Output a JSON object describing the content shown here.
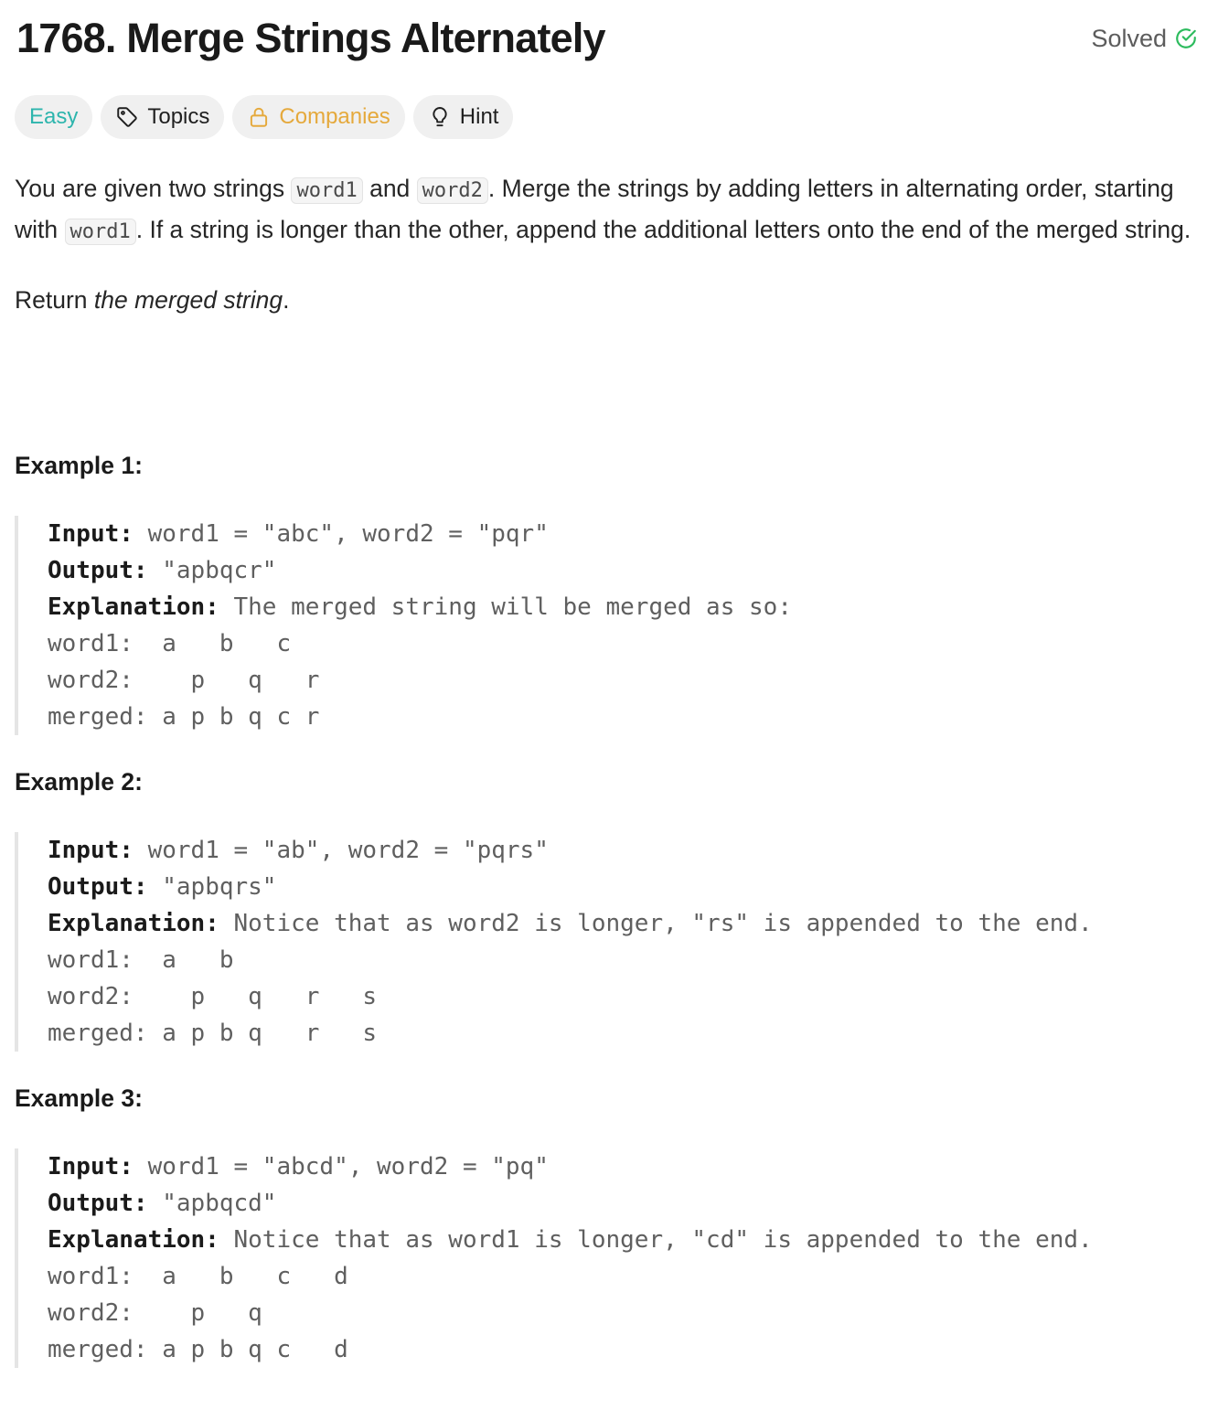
{
  "problem": {
    "title": "1768. Merge Strings Alternately",
    "status": "Solved"
  },
  "tags": {
    "difficulty": "Easy",
    "topics": "Topics",
    "companies": "Companies",
    "hint": "Hint"
  },
  "colors": {
    "easy": "#2db5ad",
    "companies": "#e5a93c",
    "solved": "#2cbb5d"
  },
  "icons": {
    "solved": "check-circle-icon",
    "topics": "tag-icon",
    "companies": "lock-icon",
    "hint": "lightbulb-icon"
  },
  "description": {
    "p1_a": "You are given two strings ",
    "code_word1": "word1",
    "p1_b": " and ",
    "code_word2": "word2",
    "p1_c": ". Merge the strings by adding letters in alternating order, starting with ",
    "p1_d": ". If a string is longer than the other, append the additional letters onto the end of the merged string.",
    "return_prefix": "Return ",
    "return_em": "the merged string",
    "return_suffix": "."
  },
  "labels": {
    "input": "Input:",
    "output": "Output:",
    "explanation": "Explanation:"
  },
  "examples": [
    {
      "title": "Example 1:",
      "input": " word1 = \"abc\", word2 = \"pqr\"",
      "output": " \"apbqcr\"",
      "explanation": " The merged string will be merged as so:",
      "line1": "word1:  a   b   c",
      "line2": "word2:    p   q   r",
      "line3": "merged: a p b q c r"
    },
    {
      "title": "Example 2:",
      "input": " word1 = \"ab\", word2 = \"pqrs\"",
      "output": " \"apbqrs\"",
      "explanation": " Notice that as word2 is longer, \"rs\" is appended to the end.",
      "line1": "word1:  a   b ",
      "line2": "word2:    p   q   r   s",
      "line3": "merged: a p b q   r   s"
    },
    {
      "title": "Example 3:",
      "input": " word1 = \"abcd\", word2 = \"pq\"",
      "output": " \"apbqcd\"",
      "explanation": " Notice that as word1 is longer, \"cd\" is appended to the end.",
      "line1": "word1:  a   b   c   d",
      "line2": "word2:    p   q ",
      "line3": "merged: a p b q c   d"
    }
  ]
}
